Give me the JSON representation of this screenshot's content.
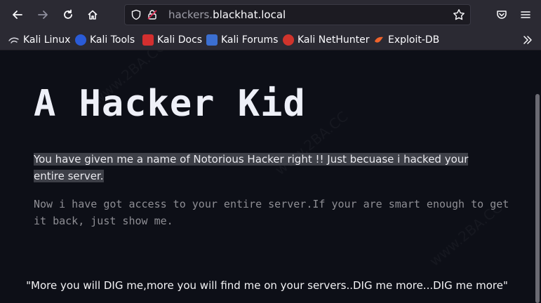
{
  "browser": {
    "url_prefix": "hackers.",
    "url_host": "blackhat.local",
    "bookmarks": [
      {
        "label": "Kali Linux",
        "icon": "kali-dragon-icon",
        "color": "#2a8af0"
      },
      {
        "label": "Kali Tools",
        "icon": "kali-tools-icon",
        "color": "#e4452b"
      },
      {
        "label": "Kali Docs",
        "icon": "kali-docs-icon",
        "color": "#d32f2f"
      },
      {
        "label": "Kali Forums",
        "icon": "kali-forums-icon",
        "color": "#3b6fd1"
      },
      {
        "label": "Kali NetHunter",
        "icon": "kali-nethunter-icon",
        "color": "#d0342c"
      },
      {
        "label": "Exploit-DB",
        "icon": "exploit-db-icon",
        "color": "#f0632b"
      }
    ]
  },
  "page": {
    "title": "A Hacker Kid",
    "intro": "You have given me a name of Notorious Hacker right !! Just becuase i hacked your entire server.",
    "message": "Now i have got access to your entire server.If your are smart enough to get it back, just show me.",
    "quote": "\"More you will DIG me,more you will find me on your servers..DIG me more...DIG me more\""
  }
}
